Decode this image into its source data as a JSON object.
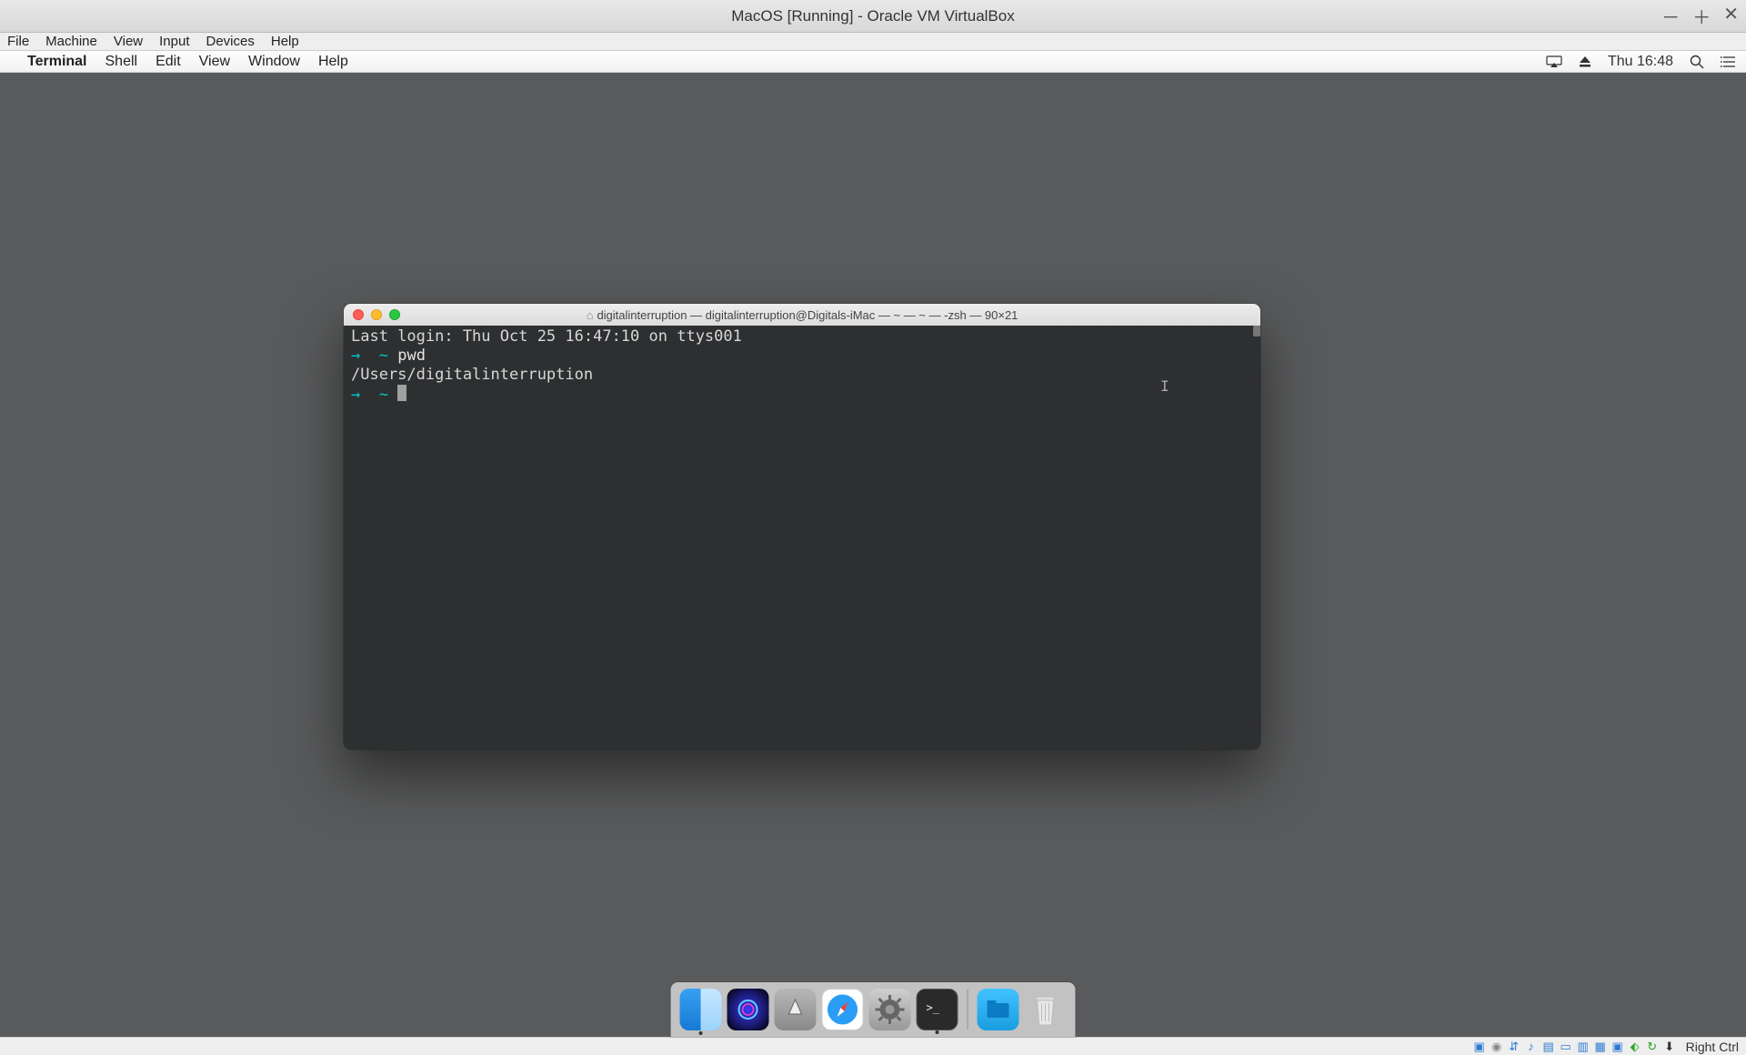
{
  "vbox": {
    "title": "MacOS [Running] - Oracle VM VirtualBox",
    "menu": [
      "File",
      "Machine",
      "View",
      "Input",
      "Devices",
      "Help"
    ],
    "statusbar_key": "Right Ctrl"
  },
  "mac_menubar": {
    "app": "Terminal",
    "items": [
      "Shell",
      "Edit",
      "View",
      "Window",
      "Help"
    ],
    "clock": "Thu 16:48"
  },
  "terminal": {
    "title": "digitalinterruption — digitalinterruption@Digitals-iMac — ~ — ~ — -zsh — 90×21",
    "last_login": "Last login: Thu Oct 25 16:47:10 on ttys001",
    "prompt1_cmd": "pwd",
    "pwd_output": "/Users/digitalinterruption",
    "arrow": "→",
    "tilde": "~"
  },
  "dock": {
    "items": [
      "finder",
      "siri",
      "launchpad",
      "safari",
      "settings",
      "terminal",
      "downloads",
      "trash"
    ]
  }
}
